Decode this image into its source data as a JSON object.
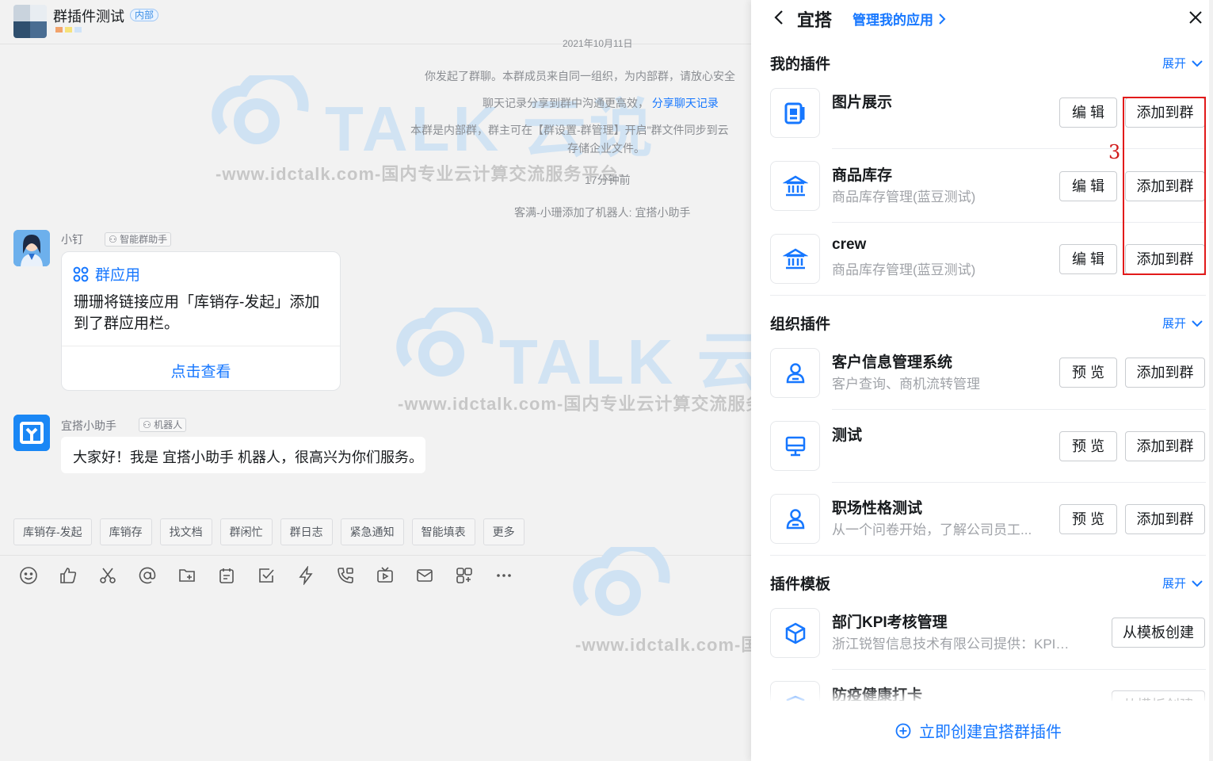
{
  "chat": {
    "group_name": "群插件测试",
    "group_badge": "内部",
    "date_label": "2021年10月11日",
    "sys_messages": {
      "msg1": "你发起了群聊。本群成员来自同一组织，为内部群，请放心安全",
      "msg2": "聊天记录分享到群中沟通更高效，",
      "msg2_link": "分享聊天记录",
      "msg3_line1": "本群是内部群，群主可在【群设置-群管理】开启\"群文件同步到云",
      "msg3_line2": "存储企业文件。",
      "time": "17分钟前",
      "msg4": "客满-小珊添加了机器人: 宜搭小助手"
    },
    "message1": {
      "sender": "小钉",
      "tag": "智能群助手",
      "card_title": "群应用",
      "card_body": "珊珊将链接应用「库销存-发起」添加到了群应用栏。",
      "card_link": "点击查看"
    },
    "message2": {
      "sender": "宜搭小助手",
      "tag": "机器人",
      "text": "大家好！我是 宜搭小助手 机器人，很高兴为你们服务。"
    },
    "quick_apps": [
      "库销存-发起",
      "库销存",
      "找文档",
      "群闲忙",
      "群日志",
      "紧急通知",
      "智能填表",
      "更多"
    ],
    "toolbar_icons": [
      "emoji-icon",
      "thumb-up-icon",
      "scissors-icon",
      "at-icon",
      "folder-add-icon",
      "calendar-icon",
      "checkbox-icon",
      "lightning-icon",
      "phone-icon",
      "live-icon",
      "mail-icon",
      "apps-icon",
      "more-icon"
    ]
  },
  "watermarks": {
    "brand": "TALK 云说",
    "url_line": "-www.idctalk.com-国内专业云计算交流服务平台-"
  },
  "panel": {
    "title": "宜搭",
    "manage_link": "管理我的应用",
    "sections": {
      "mine": {
        "title": "我的插件",
        "expand": "展开",
        "items": [
          {
            "name": "图片展示",
            "desc": "",
            "btn1": "编 辑",
            "btn2": "添加到群"
          },
          {
            "name": "商品库存",
            "desc": "商品库存管理(蓝豆测试)",
            "btn1": "编 辑",
            "btn2": "添加到群"
          },
          {
            "name": "crew",
            "desc": "商品库存管理(蓝豆测试)",
            "btn1": "编 辑",
            "btn2": "添加到群"
          }
        ]
      },
      "org": {
        "title": "组织插件",
        "expand": "展开",
        "items": [
          {
            "name": "客户信息管理系统",
            "desc": "客户查询、商机流转管理",
            "btn1": "预 览",
            "btn2": "添加到群"
          },
          {
            "name": "测试",
            "desc": "",
            "btn1": "预 览",
            "btn2": "添加到群"
          },
          {
            "name": "职场性格测试",
            "desc": "从一个问卷开始，了解公司员工...",
            "btn1": "预 览",
            "btn2": "添加到群"
          }
        ]
      },
      "templates": {
        "title": "插件模板",
        "expand": "展开",
        "items": [
          {
            "name": "部门KPI考核管理",
            "desc": "浙江锐智信息技术有限公司提供：KPI考...",
            "btn": "从模板创建"
          },
          {
            "name": "防疫健康打卡",
            "desc": "",
            "btn": "从模板创建"
          }
        ]
      }
    },
    "annotation_number": "3",
    "create_link": "立即创建宜搭群插件"
  },
  "colors": {
    "accent": "#1677ff",
    "highlight": "#e21a1a"
  }
}
